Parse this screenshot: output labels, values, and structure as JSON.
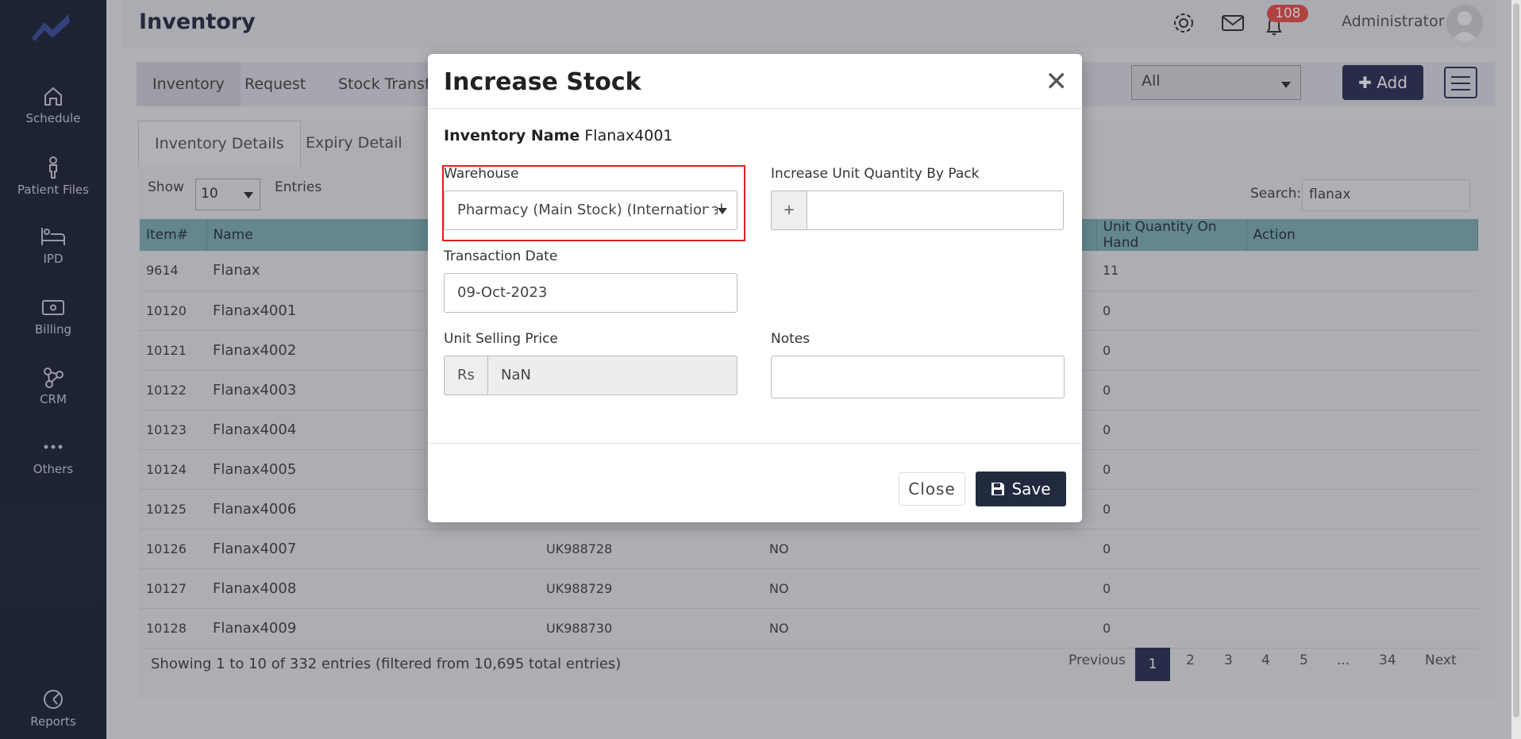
{
  "sidebar": {
    "items": [
      {
        "label": "Schedule",
        "icon": "home-icon"
      },
      {
        "label": "Patient Files",
        "icon": "person-icon"
      },
      {
        "label": "IPD",
        "icon": "bed-icon"
      },
      {
        "label": "Billing",
        "icon": "money-icon"
      },
      {
        "label": "CRM",
        "icon": "network-icon"
      },
      {
        "label": "Others",
        "icon": "more-icon"
      },
      {
        "label": "Reports",
        "icon": "chart-icon"
      }
    ]
  },
  "header": {
    "title": "Inventory",
    "notification_count": "108",
    "user": "Administrator"
  },
  "subnav": {
    "tabs": [
      "Inventory",
      "Request",
      "Stock Transfer"
    ],
    "filter_value": "All",
    "add_label": "Add"
  },
  "details_tabs": [
    "Inventory Details",
    "Expiry Detail"
  ],
  "table_controls": {
    "show_label": "Show",
    "entries_value": "10",
    "entries_label": "Entries",
    "search_label": "Search:",
    "search_value": "flanax"
  },
  "table": {
    "columns": [
      "Item#",
      "Name",
      "Unit Quantity On Hand",
      "Action"
    ],
    "rows": [
      {
        "item": "9614",
        "name": "Flanax",
        "code": "",
        "flag": "",
        "qty": "11"
      },
      {
        "item": "10120",
        "name": "Flanax4001",
        "code": "",
        "flag": "",
        "qty": "0"
      },
      {
        "item": "10121",
        "name": "Flanax4002",
        "code": "",
        "flag": "",
        "qty": "0"
      },
      {
        "item": "10122",
        "name": "Flanax4003",
        "code": "",
        "flag": "",
        "qty": "0"
      },
      {
        "item": "10123",
        "name": "Flanax4004",
        "code": "",
        "flag": "",
        "qty": "0"
      },
      {
        "item": "10124",
        "name": "Flanax4005",
        "code": "",
        "flag": "",
        "qty": "0"
      },
      {
        "item": "10125",
        "name": "Flanax4006",
        "code": "",
        "flag": "",
        "qty": "0"
      },
      {
        "item": "10126",
        "name": "Flanax4007",
        "code": "UK988728",
        "flag": "NO",
        "qty": "0"
      },
      {
        "item": "10127",
        "name": "Flanax4008",
        "code": "UK988729",
        "flag": "NO",
        "qty": "0"
      },
      {
        "item": "10128",
        "name": "Flanax4009",
        "code": "UK988730",
        "flag": "NO",
        "qty": "0"
      }
    ]
  },
  "footer": {
    "info": "Showing 1 to 10 of 332 entries (filtered from 10,695 total entries)",
    "pager": [
      "Previous",
      "1",
      "2",
      "3",
      "4",
      "5",
      "...",
      "34",
      "Next"
    ]
  },
  "modal": {
    "title": "Increase Stock",
    "inventory_name_label": "Inventory Name",
    "inventory_name_value": "Flanax4001",
    "warehouse_label": "Warehouse",
    "warehouse_value": "Pharmacy (Main Stock) (International",
    "increase_label": "Increase Unit Quantity By Pack",
    "increase_addon": "+",
    "increase_value": "",
    "date_label": "Transaction Date",
    "date_value": "09-Oct-2023",
    "price_label": "Unit Selling Price",
    "price_addon": "Rs",
    "price_value": "NaN",
    "notes_label": "Notes",
    "notes_value": "",
    "close_label": "Close",
    "save_label": "Save"
  },
  "colors": {
    "sidebar_bg": "#1f2639",
    "accent": "#2c3357",
    "table_header": "#7fb0b3",
    "highlight": "#e0201f",
    "badge": "#e8524a"
  }
}
